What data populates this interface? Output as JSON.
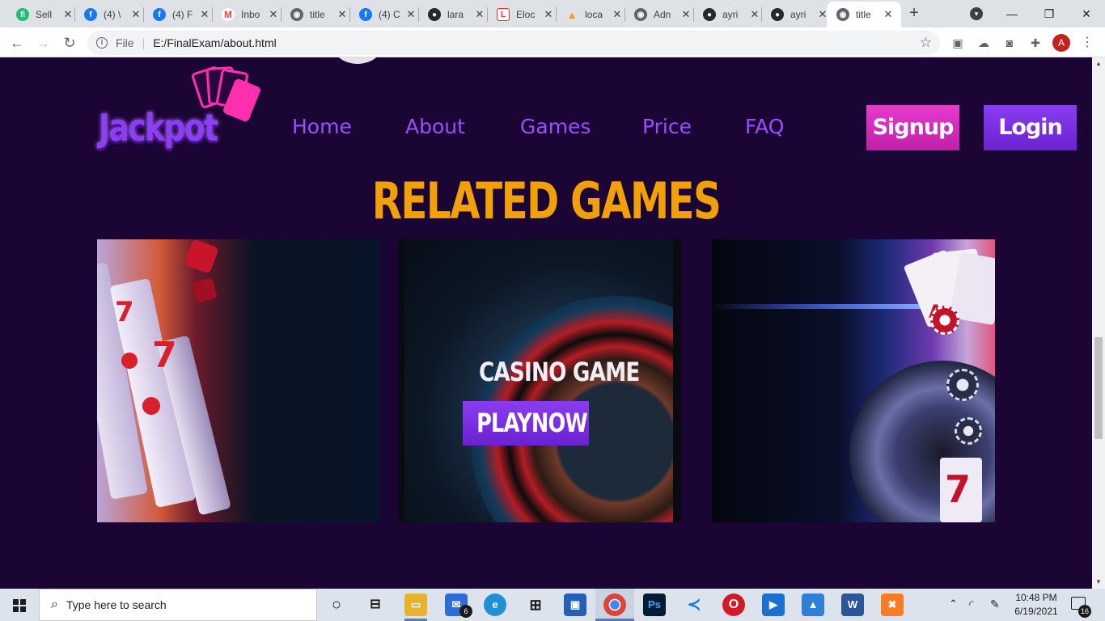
{
  "browser": {
    "tabs": [
      {
        "title": "Sell",
        "icon": "fiverr-icon",
        "color": "#1dbf73",
        "glyph": "fi"
      },
      {
        "title": "(4) \\",
        "icon": "facebook-icon",
        "color": "#1877f2",
        "glyph": "f"
      },
      {
        "title": "(4) F",
        "icon": "facebook-icon",
        "color": "#1877f2",
        "glyph": "f"
      },
      {
        "title": "Inbo",
        "icon": "gmail-icon",
        "color": "#ea4335",
        "glyph": "M"
      },
      {
        "title": "title",
        "icon": "globe-icon",
        "color": "#5f6368",
        "glyph": "◉"
      },
      {
        "title": "(4) C",
        "icon": "facebook-icon",
        "color": "#1877f2",
        "glyph": "f"
      },
      {
        "title": "lara",
        "icon": "github-icon",
        "color": "#24292e",
        "glyph": "●"
      },
      {
        "title": "Eloc",
        "icon": "laravel-icon",
        "color": "#ff2d20",
        "glyph": "L"
      },
      {
        "title": "loca",
        "icon": "phpmyadmin-icon",
        "color": "#f89c0e",
        "glyph": "▲"
      },
      {
        "title": "Adn",
        "icon": "globe-icon",
        "color": "#5f6368",
        "glyph": "◉"
      },
      {
        "title": "ayri",
        "icon": "github-icon",
        "color": "#24292e",
        "glyph": "●"
      },
      {
        "title": "ayri",
        "icon": "github-icon",
        "color": "#24292e",
        "glyph": "●"
      },
      {
        "title": "title",
        "icon": "globe-icon",
        "color": "#5f6368",
        "glyph": "◉",
        "active": true
      }
    ],
    "new_tab": "+",
    "url_scheme": "File",
    "url": "E:/FinalExam/about.html",
    "avatar_letter": "A"
  },
  "site": {
    "logo": "Jackpot",
    "nav": [
      "Home",
      "About",
      "Games",
      "Price",
      "FAQ"
    ],
    "signup": "Signup",
    "login": "Login",
    "section_title": "RELATED GAMES",
    "game_title": "CASINO GAME",
    "play_button": "PLAYNOW",
    "colors": {
      "background": "#1a0535",
      "nav": "#9d4dff",
      "accent": "#f2a007",
      "signup": "#d42cbc",
      "login": "#7b30e0"
    }
  },
  "taskbar": {
    "search_placeholder": "Type here to search",
    "mail_badge": "6",
    "time": "10:48 PM",
    "date": "6/19/2021",
    "notification_count": "16"
  }
}
